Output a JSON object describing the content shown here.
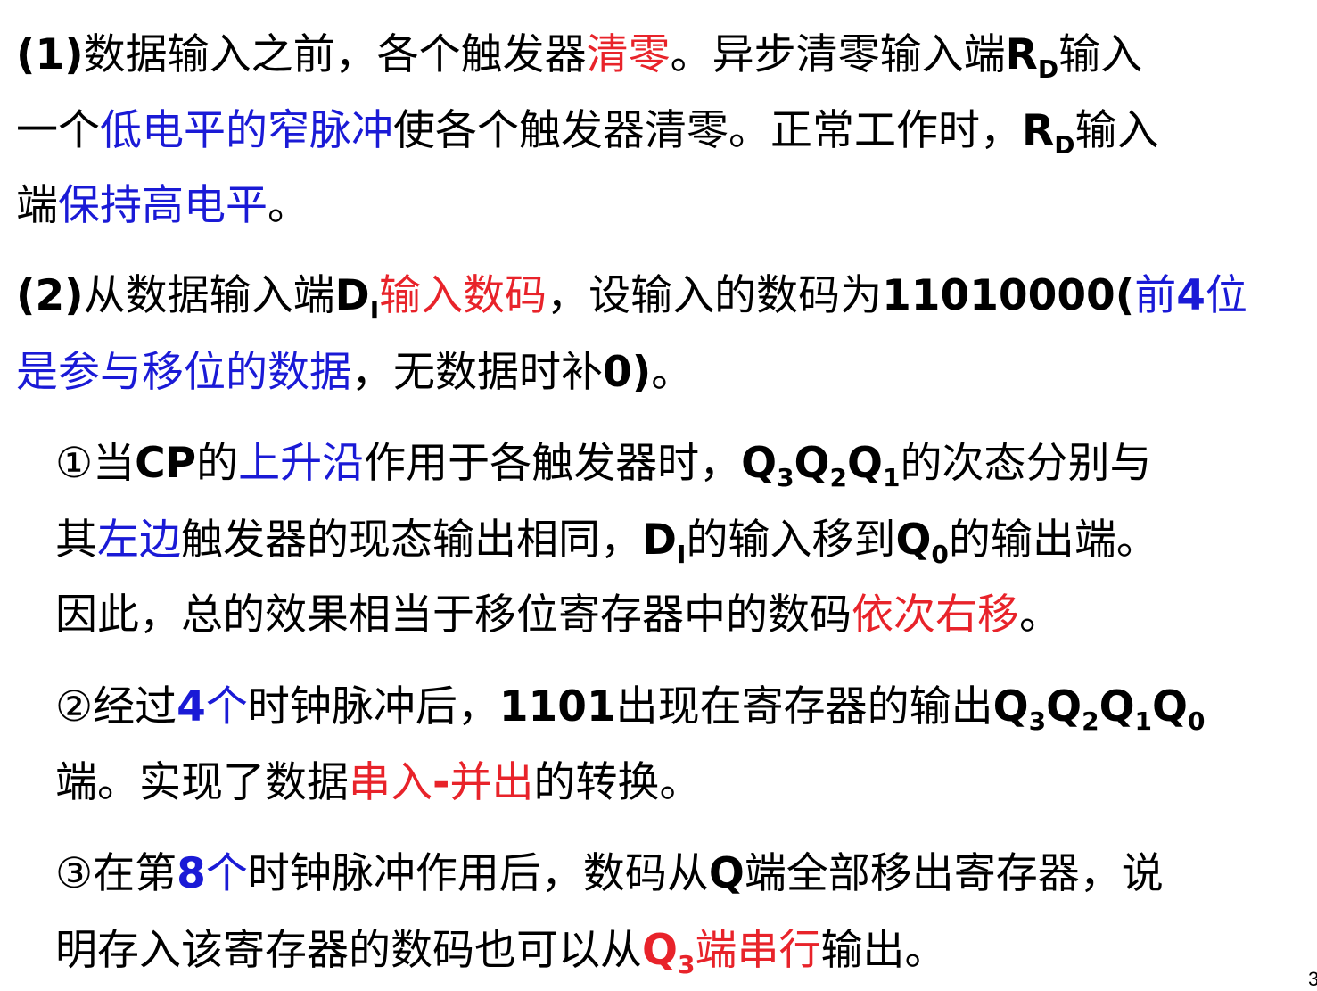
{
  "colors": {
    "text": "#000000",
    "red": "#e8232a",
    "blue": "#1a1ad6"
  },
  "lines": [
    [
      {
        "t": "(1)",
        "s": "b"
      },
      {
        "t": "数据输入之前，各个触发器"
      },
      {
        "t": "清零",
        "s": "red"
      },
      {
        "t": "。异步清零输入端"
      },
      {
        "t": "R",
        "s": "b"
      },
      {
        "t": "D",
        "s": "sub"
      },
      {
        "t": "输入"
      }
    ],
    [
      {
        "t": "一个"
      },
      {
        "t": "低电平的窄脉冲",
        "s": "blue"
      },
      {
        "t": "使各个触发器清零。正常工作时，"
      },
      {
        "t": "R",
        "s": "b"
      },
      {
        "t": "D",
        "s": "sub"
      },
      {
        "t": "输入"
      }
    ],
    [
      {
        "t": "端"
      },
      {
        "t": "保持高电平",
        "s": "blue"
      },
      {
        "t": "。"
      }
    ],
    [
      {
        "t": "(2)",
        "s": "b"
      },
      {
        "t": "从数据输入端"
      },
      {
        "t": "D",
        "s": "b"
      },
      {
        "t": "I",
        "s": "sub"
      },
      {
        "t": "输入数码",
        "s": "red"
      },
      {
        "t": "，设输入的数码为"
      },
      {
        "t": "11010000(",
        "s": "b"
      },
      {
        "t": "前",
        "s": "blue"
      },
      {
        "t": "4",
        "s": "b blue"
      },
      {
        "t": "位",
        "s": "blue"
      }
    ],
    [
      {
        "t": "是参与移位的数据",
        "s": "blue"
      },
      {
        "t": "，无数据时补"
      },
      {
        "t": "0)",
        "s": "b"
      },
      {
        "t": "。"
      }
    ],
    [
      {
        "t": "①当"
      },
      {
        "t": "CP",
        "s": "b"
      },
      {
        "t": "的"
      },
      {
        "t": "上升沿",
        "s": "blue"
      },
      {
        "t": "作用于各触发器时，"
      },
      {
        "t": "Q",
        "s": "b"
      },
      {
        "t": "3",
        "s": "sub"
      },
      {
        "t": "Q",
        "s": "b"
      },
      {
        "t": "2",
        "s": "sub"
      },
      {
        "t": "Q",
        "s": "b"
      },
      {
        "t": "1",
        "s": "sub"
      },
      {
        "t": "的次态分别与"
      }
    ],
    [
      {
        "t": "其"
      },
      {
        "t": "左边",
        "s": "blue"
      },
      {
        "t": "触发器的现态输出相同，"
      },
      {
        "t": "D",
        "s": "b"
      },
      {
        "t": "I",
        "s": "sub"
      },
      {
        "t": "的输入移到"
      },
      {
        "t": "Q",
        "s": "b"
      },
      {
        "t": "0",
        "s": "sub"
      },
      {
        "t": "的输出端。"
      }
    ],
    [
      {
        "t": "因此，总的效果相当于移位寄存器中的数码"
      },
      {
        "t": "依次右移",
        "s": "red"
      },
      {
        "t": "。"
      }
    ],
    [
      {
        "t": "②经过"
      },
      {
        "t": "4",
        "s": "b blue"
      },
      {
        "t": "个",
        "s": "blue"
      },
      {
        "t": "时钟脉冲后，"
      },
      {
        "t": "1101",
        "s": "b"
      },
      {
        "t": "出现在寄存器的输出"
      },
      {
        "t": "Q",
        "s": "b"
      },
      {
        "t": "3",
        "s": "sub"
      },
      {
        "t": "Q",
        "s": "b"
      },
      {
        "t": "2",
        "s": "sub"
      },
      {
        "t": "Q",
        "s": "b"
      },
      {
        "t": "1",
        "s": "sub"
      },
      {
        "t": "Q",
        "s": "b"
      },
      {
        "t": "0",
        "s": "sub"
      }
    ],
    [
      {
        "t": "端。实现了数据"
      },
      {
        "t": "串入",
        "s": "red"
      },
      {
        "t": "-",
        "s": "b red"
      },
      {
        "t": "并出",
        "s": "red"
      },
      {
        "t": "的转换。"
      }
    ],
    [
      {
        "t": "③在第"
      },
      {
        "t": "8",
        "s": "b blue"
      },
      {
        "t": "个",
        "s": "blue"
      },
      {
        "t": "时钟脉冲作用后，数码从"
      },
      {
        "t": "Q",
        "s": "b"
      },
      {
        "t": "端全部移出寄存器，说"
      }
    ],
    [
      {
        "t": "明存入该寄存器的数码也可以从"
      },
      {
        "t": "Q",
        "s": "b red"
      },
      {
        "t": "3",
        "s": "sub red"
      },
      {
        "t": "端串行",
        "s": "red"
      },
      {
        "t": "输出。"
      }
    ]
  ],
  "page_number": "3"
}
